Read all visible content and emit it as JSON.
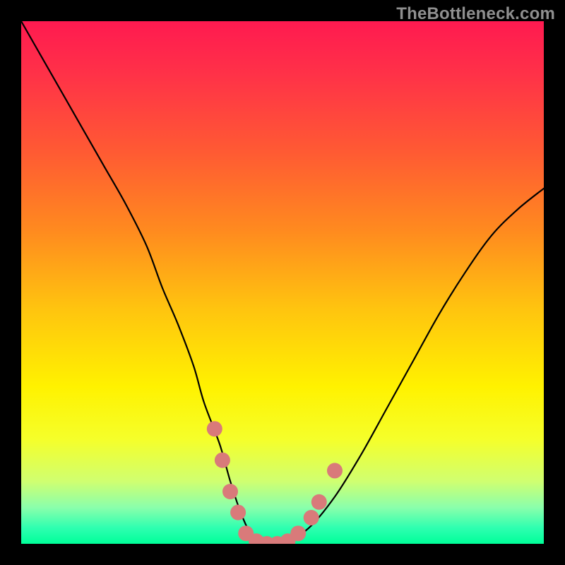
{
  "watermark": "TheBottleneck.com",
  "chart_data": {
    "type": "line",
    "title": "",
    "xlabel": "",
    "ylabel": "",
    "xlim": [
      0,
      100
    ],
    "ylim": [
      0,
      100
    ],
    "grid": false,
    "legend": null,
    "series": [
      {
        "name": "bottleneck-curve",
        "x": [
          0,
          4,
          8,
          12,
          16,
          20,
          24,
          27,
          30,
          33,
          35,
          38,
          40,
          42,
          44,
          47,
          50,
          55,
          60,
          65,
          70,
          75,
          80,
          85,
          90,
          95,
          100
        ],
        "values": [
          100,
          93,
          86,
          79,
          72,
          65,
          57,
          49,
          42,
          34,
          27,
          19,
          12,
          6,
          2,
          0,
          0,
          3,
          9,
          17,
          26,
          35,
          44,
          52,
          59,
          64,
          68
        ]
      }
    ],
    "markers": {
      "name": "highlight-points",
      "color": "#d97a7a",
      "points": [
        {
          "x": 37.0,
          "y": 22
        },
        {
          "x": 38.5,
          "y": 16
        },
        {
          "x": 40.0,
          "y": 10
        },
        {
          "x": 41.5,
          "y": 6
        },
        {
          "x": 43.0,
          "y": 2
        },
        {
          "x": 45.0,
          "y": 0.5
        },
        {
          "x": 47.0,
          "y": 0
        },
        {
          "x": 49.0,
          "y": 0
        },
        {
          "x": 51.0,
          "y": 0.5
        },
        {
          "x": 53.0,
          "y": 2
        },
        {
          "x": 55.5,
          "y": 5
        },
        {
          "x": 57.0,
          "y": 8
        },
        {
          "x": 60.0,
          "y": 14
        }
      ]
    },
    "background_gradient": {
      "stops": [
        {
          "offset": 0.0,
          "color": "#ff1a50"
        },
        {
          "offset": 0.1,
          "color": "#ff3148"
        },
        {
          "offset": 0.25,
          "color": "#ff5a33"
        },
        {
          "offset": 0.4,
          "color": "#ff8a1f"
        },
        {
          "offset": 0.55,
          "color": "#ffc40f"
        },
        {
          "offset": 0.7,
          "color": "#fff200"
        },
        {
          "offset": 0.8,
          "color": "#f5ff2a"
        },
        {
          "offset": 0.88,
          "color": "#d0ff70"
        },
        {
          "offset": 0.93,
          "color": "#8bffab"
        },
        {
          "offset": 0.97,
          "color": "#2dffb0"
        },
        {
          "offset": 1.0,
          "color": "#00ff99"
        }
      ]
    }
  }
}
